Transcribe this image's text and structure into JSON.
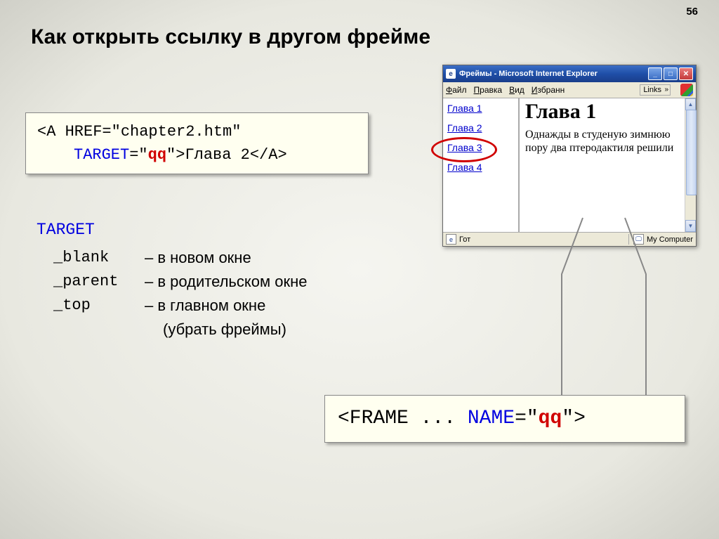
{
  "page_number": "56",
  "title": "Как открыть ссылку в другом фрейме",
  "code1": {
    "open": "<A HREF=\"chapter2.htm\"",
    "target_attr": "TARGET",
    "eq": "=\"",
    "target_val": "qq",
    "close_q": "\">",
    "link_text": "Глава 2",
    "close_a": "</A>"
  },
  "target_heading": "TARGET",
  "targets": {
    "blank": {
      "val": "_blank",
      "desc": "– в новом окне"
    },
    "parent": {
      "val": "_parent",
      "desc": "– в родительском окне"
    },
    "top": {
      "val": "_top",
      "desc": "– в главном окне",
      "extra": "(убрать фреймы)"
    }
  },
  "code2": {
    "frame_open": "<FRAME ... ",
    "name_attr": "NAME",
    "eq": "=\"",
    "val": "qq",
    "close": "\">"
  },
  "browser": {
    "title": "Фреймы - Microsoft Internet Explorer",
    "menus": [
      "Файл",
      "Правка",
      "Вид",
      "Избранн"
    ],
    "links_label": "Links",
    "chapters": [
      "Глава 1",
      "Глава 2",
      "Глава 3",
      "Глава 4"
    ],
    "content_title": "Глава 1",
    "content_body": "Однажды в студеную зимнюю пору два птеродактиля решили",
    "status_left": "Гот",
    "status_right": "My Computer"
  }
}
